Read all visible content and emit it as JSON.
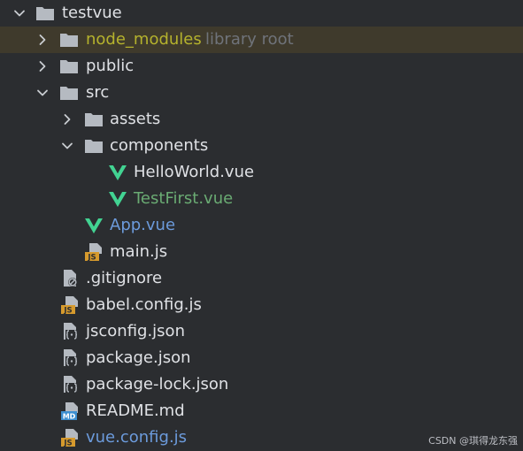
{
  "colors": {
    "default": "#dfe1e5",
    "excluded": "#b5b22d",
    "modified": "#6c9bdc",
    "added": "#6aab73",
    "folder": "#b5bac1",
    "vue": "#42d392",
    "js_badge": "#d69a2d",
    "md_badge": "#3d8fd1",
    "hint": "#6f737a"
  },
  "tree": {
    "root": {
      "label": "testvue",
      "icon": "folder-icon"
    },
    "node_modules": {
      "label": "node_modules",
      "hint": "library root",
      "icon": "folder-icon"
    },
    "public": {
      "label": "public",
      "icon": "folder-icon"
    },
    "src": {
      "label": "src",
      "icon": "folder-icon"
    },
    "assets": {
      "label": "assets",
      "icon": "folder-icon"
    },
    "components": {
      "label": "components",
      "icon": "folder-icon"
    },
    "helloworld": {
      "label": "HelloWorld.vue",
      "icon": "vue-icon"
    },
    "testfirst": {
      "label": "TestFirst.vue",
      "icon": "vue-icon"
    },
    "app": {
      "label": "App.vue",
      "icon": "vue-icon"
    },
    "mainjs": {
      "label": "main.js",
      "icon": "js-file-icon"
    },
    "gitignore": {
      "label": ".gitignore",
      "icon": "ignore-file-icon"
    },
    "babel": {
      "label": "babel.config.js",
      "icon": "js-file-icon"
    },
    "jsconfig": {
      "label": "jsconfig.json",
      "icon": "json-file-icon"
    },
    "package": {
      "label": "package.json",
      "icon": "json-file-icon"
    },
    "packagelock": {
      "label": "package-lock.json",
      "icon": "json-file-icon"
    },
    "readme": {
      "label": "README.md",
      "icon": "markdown-file-icon"
    },
    "vueconfig": {
      "label": "vue.config.js",
      "icon": "js-file-icon"
    }
  },
  "badges": {
    "js": "JS",
    "md": "MD"
  },
  "watermark": "CSDN @琪得龙东强"
}
